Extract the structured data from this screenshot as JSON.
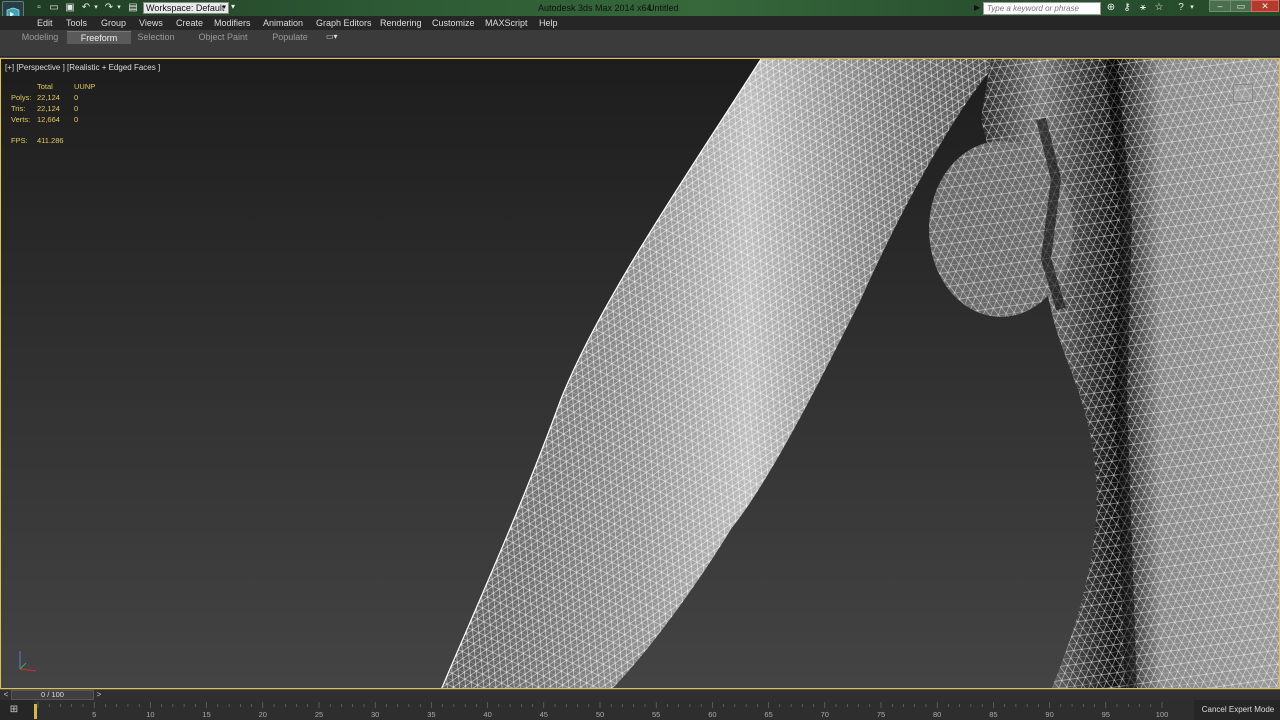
{
  "titlebar": {
    "workspace": "Workspace: Default",
    "app_title": "Autodesk 3ds Max  2014 x64",
    "filename": "Untitled",
    "search_placeholder": "Type a keyword or phrase",
    "colors": {
      "bar": "#2d5a34",
      "close": "#b43b2c"
    }
  },
  "quick_access_icons": [
    "new-file-icon",
    "open-file-icon",
    "save-icon",
    "undo-icon",
    "redo-icon",
    "project-folder-icon"
  ],
  "help_icons": [
    "binoculars-icon",
    "key-icon",
    "communication-center-icon",
    "star-icon",
    "help-icon"
  ],
  "menu": {
    "items": [
      "Edit",
      "Tools",
      "Group",
      "Views",
      "Create",
      "Modifiers",
      "Animation",
      "Graph Editors",
      "Rendering",
      "Customize",
      "MAXScript",
      "Help"
    ]
  },
  "ribbon": {
    "tabs": [
      "Modeling",
      "Freeform",
      "Selection",
      "Object Paint",
      "Populate"
    ],
    "active_tab": "Freeform"
  },
  "viewport": {
    "label": "[+] [Perspective ] [Realistic + Edged Faces ]",
    "stats": {
      "header_total": "Total",
      "header_selected": "UUNP",
      "rows": [
        {
          "label": "Polys:",
          "total": "22,124",
          "selected": "0"
        },
        {
          "label": "Tris:",
          "total": "22,124",
          "selected": "0"
        },
        {
          "label": "Verts:",
          "total": "12,664",
          "selected": "0"
        }
      ],
      "fps_label": "FPS:",
      "fps_value": "411.286"
    },
    "border_color": "#e0c14a"
  },
  "timeslider": {
    "position": "0 / 100"
  },
  "trackbar": {
    "ticks": [
      "5",
      "10",
      "15",
      "20",
      "25",
      "30",
      "35",
      "40",
      "45",
      "50",
      "55",
      "60",
      "65",
      "70",
      "75",
      "80",
      "85",
      "90",
      "95",
      "100"
    ],
    "cancel_label": "Cancel Expert Mode"
  }
}
